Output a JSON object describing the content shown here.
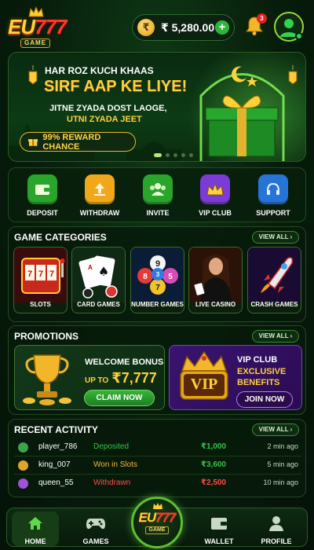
{
  "brand": {
    "name_prefix": "EU",
    "name_digits": "777",
    "tag": "GAME"
  },
  "header": {
    "balance": "₹ 5,280.00",
    "currency_symbol": "₹",
    "notification_count": "3"
  },
  "banner": {
    "line1": "HAR ROZ KUCH KHAAS",
    "line2": "SIRF AAP KE LIYE!",
    "line3": "JITNE ZYADA DOST LAOGE,",
    "line4": "UTNI ZYADA JEET",
    "chance_label": "99% REWARD CHANCE",
    "slide_count": 5,
    "active_slide": 1
  },
  "actions": [
    {
      "label": "DEPOSIT",
      "icon": "wallet-icon",
      "color": "#2aa52c"
    },
    {
      "label": "WITHDRAW",
      "icon": "upload-icon",
      "color": "#f0a81a"
    },
    {
      "label": "INVITE",
      "icon": "users-icon",
      "color": "#2aa52c"
    },
    {
      "label": "VIP CLUB",
      "icon": "crown-icon",
      "color": "#7a3bd6"
    },
    {
      "label": "SUPPORT",
      "icon": "headset-icon",
      "color": "#2774d8"
    }
  ],
  "categories": {
    "title": "GAME CATEGORIES",
    "view_all": "VIEW ALL",
    "items": [
      {
        "label": "SLOTS",
        "icon": "slot-machine-icon"
      },
      {
        "label": "CARD GAMES",
        "icon": "cards-icon"
      },
      {
        "label": "NUMBER GAMES",
        "icon": "lottery-balls-icon"
      },
      {
        "label": "LIVE CASINO",
        "icon": "dealer-icon"
      },
      {
        "label": "CRASH GAMES",
        "icon": "rocket-icon"
      }
    ]
  },
  "promotions": {
    "title": "PROMOTIONS",
    "view_all": "VIEW ALL",
    "welcome": {
      "title": "WELCOME BONUS",
      "up_to": "UP TO",
      "amount": "₹7,777",
      "button": "CLAIM NOW"
    },
    "vip": {
      "title": "VIP CLUB",
      "line1": "EXCLUSIVE",
      "line2": "BENEFITS",
      "badge": "VIP",
      "button": "JOIN NOW"
    }
  },
  "activity": {
    "title": "RECENT ACTIVITY",
    "view_all": "VIEW ALL",
    "rows": [
      {
        "user": "player_786",
        "action": "Deposited",
        "amount": "₹1,000",
        "time": "2 min ago",
        "status_color": "#35c24a",
        "avatar_color": "#3ba34a"
      },
      {
        "user": "king_007",
        "action": "Won in Slots",
        "amount": "₹3,600",
        "time": "5 min ago",
        "status_color": "#f2b640",
        "avatar_color": "#e0a526"
      },
      {
        "user": "queen_55",
        "action": "Withdrawn",
        "amount": "₹2,500",
        "time": "10 min ago",
        "status_color": "#ff4a4a",
        "avatar_color": "#a052d8"
      }
    ]
  },
  "nav": {
    "home": "HOME",
    "games": "GAMES",
    "wallet": "WALLET",
    "profile": "PROFILE",
    "active": "home"
  }
}
